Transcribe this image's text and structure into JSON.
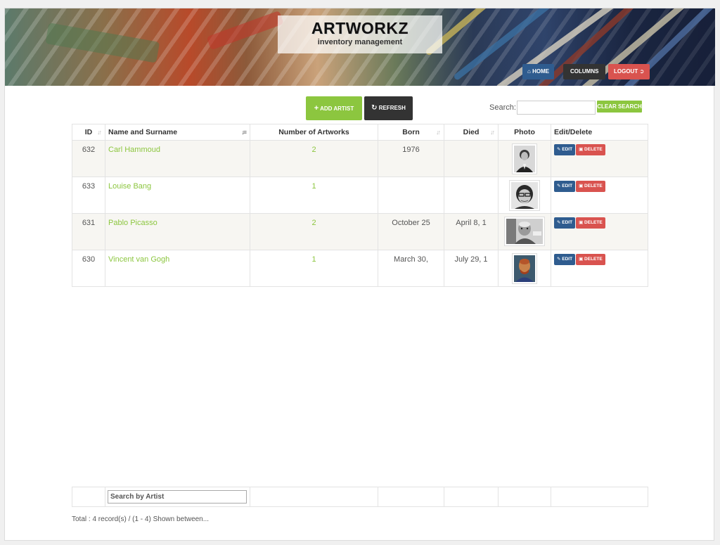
{
  "header": {
    "title": "ARTWORKZ",
    "subtitle": "inventory management",
    "nav": {
      "home": "HOME",
      "columns": "COLUMNS",
      "logout": "LOGOUT"
    }
  },
  "toolbar": {
    "add_artist": "ADD ARTIST",
    "refresh": "REFRESH",
    "search_label": "Search:",
    "search_value": "",
    "clear_search": "CLEAR SEARCH"
  },
  "table": {
    "columns": {
      "id": "ID",
      "name": "Name and Surname",
      "count": "Number of Artworks",
      "born": "Born",
      "died": "Died",
      "photo": "Photo",
      "actions": "Edit/Delete"
    },
    "edit_label": "EDIT",
    "delete_label": "DELETE",
    "rows": [
      {
        "id": "632",
        "name": "Carl Hammoud",
        "count": "2",
        "born": "1976",
        "died": "",
        "photo": "portrait-man-suit"
      },
      {
        "id": "633",
        "name": "Louise Bang",
        "count": "1",
        "born": "",
        "died": "",
        "photo": "portrait-woman-glasses"
      },
      {
        "id": "631",
        "name": "Pablo Picasso",
        "count": "2",
        "born": "October 25",
        "died": "April 8, 1",
        "photo": "portrait-picasso"
      },
      {
        "id": "630",
        "name": "Vincent van Gogh",
        "count": "1",
        "born": "March 30,",
        "died": "July 29, 1",
        "photo": "portrait-van-gogh"
      }
    ]
  },
  "filter": {
    "artist_value": "Search by Artist"
  },
  "footer": {
    "total": "Total : 4 record(s) / (1 - 4) Shown between..."
  },
  "colors": {
    "accent_green": "#8cc63f",
    "primary_blue": "#2f5c8f",
    "danger_red": "#d9534f",
    "dark": "#333333"
  }
}
